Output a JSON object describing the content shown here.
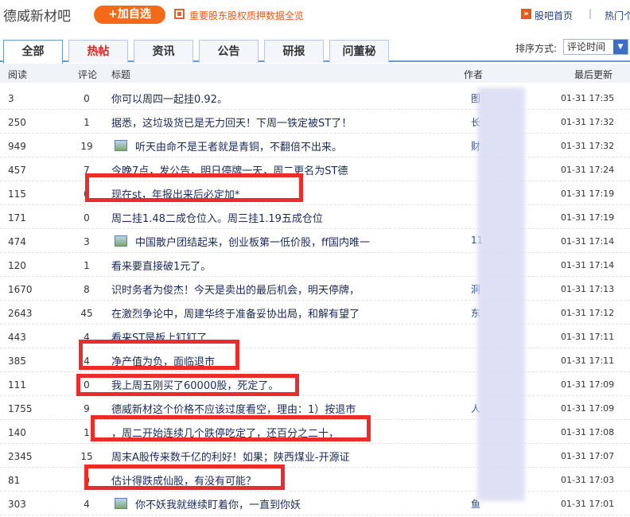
{
  "header": {
    "title": "德威新材吧",
    "add_btn": "+加自选",
    "notice": "重要股东股权质押数据全览",
    "guba_home": "股吧首页",
    "sep": "|",
    "hot": "热门个股"
  },
  "tabs": [
    {
      "label": "全部",
      "active": true
    },
    {
      "label": "热帖",
      "red": true
    },
    {
      "label": "资讯"
    },
    {
      "label": "公告"
    },
    {
      "label": "研报"
    },
    {
      "label": "问董秘"
    }
  ],
  "sort": {
    "label": "排序方式:",
    "value": "评论时间"
  },
  "columns": {
    "read": "阅读",
    "comment": "评论",
    "title": "标题",
    "author": "作者",
    "updated": "最后更新"
  },
  "rows": [
    {
      "read": "3",
      "comments": "0",
      "title": "你可以周四一起挂0.92。",
      "author": "图",
      "time": "01-31 17:35",
      "icon": false
    },
    {
      "read": "250",
      "comments": "1",
      "title": "据悉，这垃圾货已是无力回天！下周一铁定被ST了！",
      "author": "长",
      "time": "01-31 17:32",
      "icon": false
    },
    {
      "read": "949",
      "comments": "19",
      "title": "听天由命不是王者就是青铜，不翻倍不出来。",
      "author": "财",
      "time": "01-31 17:32",
      "icon": true
    },
    {
      "read": "457",
      "comments": "7",
      "title": "今晚7点，发公告，明日停牌一天，周二更名为ST德",
      "author": "",
      "time": "01-31 17:24",
      "icon": false
    },
    {
      "read": "115",
      "comments": "0",
      "title": "现在st，年报出来后必定加*",
      "author": "",
      "time": "01-31 17:19",
      "icon": false
    },
    {
      "read": "171",
      "comments": "0",
      "title": "周二挂1.48二成仓位入。周三挂1.19五成仓位",
      "author": "",
      "time": "01-31 17:19",
      "icon": false
    },
    {
      "read": "474",
      "comments": "3",
      "title": "中国散户团结起来，创业板第一低价股，ff国内唯一",
      "author": "11",
      "time": "01-31 17:14",
      "icon": true
    },
    {
      "read": "120",
      "comments": "1",
      "title": "看来要直接破1元了。",
      "author": "",
      "time": "01-31 17:14",
      "icon": false
    },
    {
      "read": "1670",
      "comments": "8",
      "title": "识时务者为俊杰！今天是卖出的最后机会，明天停牌，",
      "author": "洞",
      "time": "01-31 17:13",
      "icon": false
    },
    {
      "read": "2643",
      "comments": "45",
      "title": "在激烈争论中，周建华终于准备妥协出局，和解有望了",
      "author": "东",
      "time": "01-31 17:12",
      "icon": false
    },
    {
      "read": "443",
      "comments": "4",
      "title": "看来ST是板上钉钉了",
      "author": "",
      "time": "01-31 17:11",
      "icon": false
    },
    {
      "read": "385",
      "comments": "4",
      "title": "净产值为负，面临退市",
      "author": "",
      "time": "01-31 17:11",
      "icon": false
    },
    {
      "read": "111",
      "comments": "0",
      "title": "我上周五刚买了60000股，死定了。",
      "author": "",
      "time": "01-31 17:09",
      "icon": false
    },
    {
      "read": "1755",
      "comments": "9",
      "title": "德威新材这个价格不应该过度看空，理由：1）按退市",
      "author": "人",
      "time": "01-31 17:09",
      "icon": false
    },
    {
      "read": "140",
      "comments": "1",
      "title": "，周二开始连续几个跌停吃定了，还百分之二十，",
      "author": "",
      "time": "01-31 17:08",
      "icon": false
    },
    {
      "read": "2345",
      "comments": "15",
      "title": "周末A股传来数千亿的利好！如果；陕西煤业-开源证",
      "author": "",
      "time": "01-31 17:07",
      "icon": false
    },
    {
      "read": "81",
      "comments": "0",
      "title": "估计得跌成仙股，有没有可能？",
      "author": "",
      "time": "01-31 17:03",
      "icon": false
    },
    {
      "read": "303",
      "comments": "4",
      "title": "你不妖我就继续盯着你，一直到你妖",
      "author": "鱼",
      "time": "01-31 17:01",
      "icon": true
    }
  ]
}
